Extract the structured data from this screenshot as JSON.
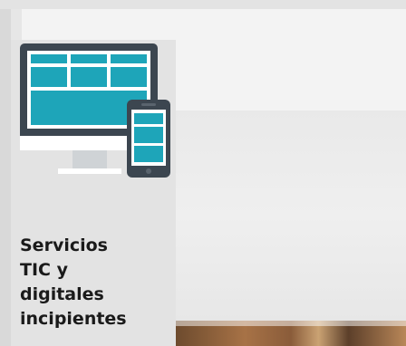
{
  "section": {
    "title": "Servicios\nTIC y\ndigitales\nincipientes",
    "icon": "desktop-and-mobile-icon"
  },
  "colors": {
    "icon_dark": "#3c4650",
    "icon_teal": "#1ea5b9",
    "card_bg": "#e3e3e3",
    "title_text": "#1a1a1a"
  }
}
